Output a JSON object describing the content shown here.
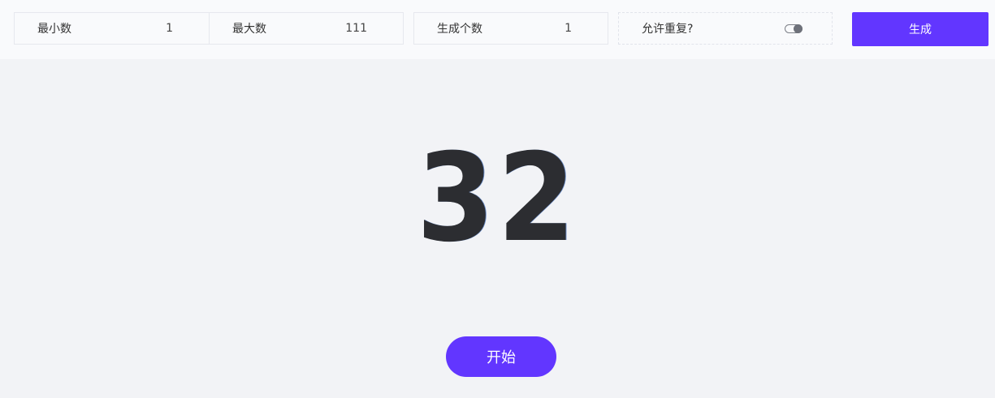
{
  "settings": {
    "min": {
      "label": "最小数",
      "value": "1"
    },
    "max": {
      "label": "最大数",
      "value": "111"
    },
    "count": {
      "label": "生成个数",
      "value": "1"
    },
    "allow_duplicates": {
      "label": "允许重复?",
      "enabled": true
    }
  },
  "generate_label": "生成",
  "result": "32",
  "start_label": "开始",
  "colors": {
    "accent": "#6236ff",
    "background": "#f2f3f6",
    "toolbar": "#f9fafc",
    "number": "#2c2d31"
  }
}
